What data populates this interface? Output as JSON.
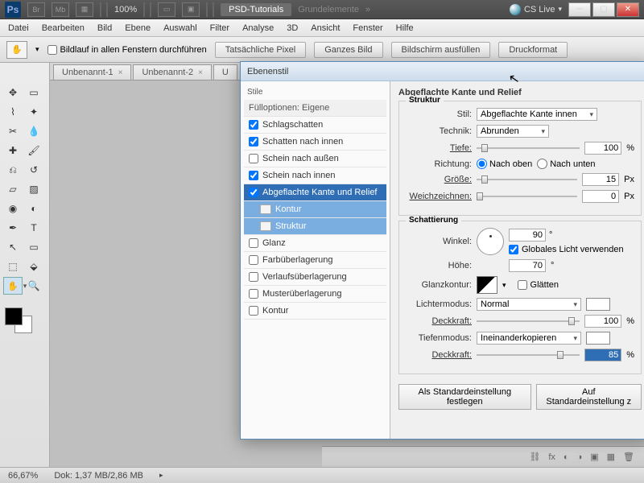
{
  "topbar": {
    "ps": "Ps",
    "br": "Br",
    "mb": "Mb",
    "zoom": "100%",
    "psd_tut": "PSD-Tutorials",
    "grund": "Grundelemente",
    "chev": "»",
    "cslive": "CS Live"
  },
  "menu": [
    "Datei",
    "Bearbeiten",
    "Bild",
    "Ebene",
    "Auswahl",
    "Filter",
    "Analyse",
    "3D",
    "Ansicht",
    "Fenster",
    "Hilfe"
  ],
  "optbar": {
    "scroll_all": "Bildlauf in allen Fenstern durchführen",
    "btns": [
      "Tatsächliche Pixel",
      "Ganzes Bild",
      "Bildschirm ausfüllen",
      "Druckformat"
    ]
  },
  "tabs": [
    "Unbenannt-1",
    "Unbenannt-2",
    "U"
  ],
  "status": {
    "zoom": "66,67%",
    "doc": "Dok: 1,37 MB/2,86 MB"
  },
  "dialog": {
    "title": "Ebenenstil",
    "stile": "Stile",
    "fill_hdr": "Fülloptionen: Eigene",
    "styles": {
      "drop": "Schlagschatten",
      "inner_shadow": "Schatten nach innen",
      "outer_glow": "Schein nach außen",
      "inner_glow": "Schein nach innen",
      "bevel": "Abgeflachte Kante und Relief",
      "contour": "Kontur",
      "texture": "Struktur",
      "satin": "Glanz",
      "color_ov": "Farbüberlagerung",
      "grad_ov": "Verlaufsüberlagerung",
      "pat_ov": "Musterüberlagerung",
      "stroke": "Kontur"
    },
    "sect_title": "Abgeflachte Kante und Relief",
    "struct": "Struktur",
    "stil": "Stil:",
    "stil_v": "Abgeflachte Kante innen",
    "tech": "Technik:",
    "tech_v": "Abrunden",
    "depth": "Tiefe:",
    "depth_v": "100",
    "pct": "%",
    "dir": "Richtung:",
    "dir_up": "Nach oben",
    "dir_down": "Nach unten",
    "size": "Größe:",
    "size_v": "15",
    "px": "Px",
    "soft": "Weichzeichnen:",
    "soft_v": "0",
    "shade": "Schattierung",
    "angle": "Winkel:",
    "angle_v": "90",
    "deg": "°",
    "global": "Globales Licht verwenden",
    "alt": "Höhe:",
    "alt_v": "70",
    "gloss": "Glanzkontur:",
    "aa": "Glätten",
    "himode": "Lichtermodus:",
    "himode_v": "Normal",
    "opac": "Deckkraft:",
    "opac_hi_v": "100",
    "shmode": "Tiefenmodus:",
    "shmode_v": "Ineinanderkopieren",
    "opac_sh_v": "85",
    "btn_def": "Als Standardeinstellung festlegen",
    "btn_rst": "Auf Standardeinstellung z"
  }
}
